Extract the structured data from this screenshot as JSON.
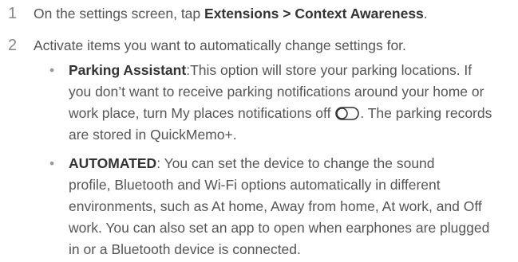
{
  "steps": [
    {
      "number": "1",
      "prefix": "On the settings screen, tap ",
      "path_a": "Extensions",
      "separator": " > ",
      "path_b": "Context Awareness",
      "suffix": "."
    },
    {
      "number": "2",
      "text": "Activate items you want to automatically change settings for."
    }
  ],
  "bullets": [
    {
      "bullet": "•",
      "title": "Parking Assistant",
      "colon": ":",
      "lines": [
        "This option will store your parking locations. If",
        "you don’t want to receive parking notifications around your home or",
        "work place, turn My places notifications off",
        ". The parking records",
        "are stored in QuickMemo+."
      ],
      "icon": "toggle-off-icon"
    },
    {
      "bullet": "•",
      "title": "AUTOMATED",
      "colon": ":",
      "lines": [
        " You can set the device to change the sound",
        "profile, Bluetooth and Wi-Fi options automatically in different",
        "environments, such as At home, Away from home, At work, and Off",
        "work. You can also set an app to open when earphones are plugged",
        "in or a Bluetooth device is connected."
      ]
    }
  ]
}
